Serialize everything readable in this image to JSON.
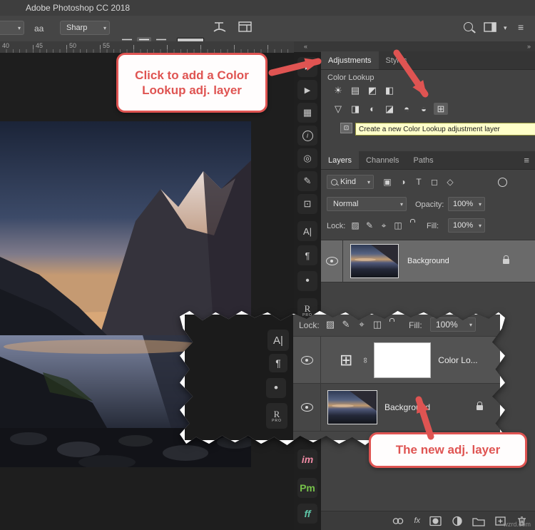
{
  "window": {
    "title": "Adobe Photoshop CC 2018"
  },
  "options_bar": {
    "aa_label": "aa",
    "antialias_value": "Sharp"
  },
  "ruler": {
    "ticks": [
      "40",
      "45",
      "50",
      "55"
    ]
  },
  "ui": {
    "chevron_down": "▾",
    "menu": "≡",
    "collapse_left": "«",
    "collapse_right": "»"
  },
  "dock": {
    "items": [
      {
        "name": "history",
        "glyph": "▸"
      },
      {
        "name": "actions",
        "glyph": "▶"
      },
      {
        "name": "tool-presets",
        "glyph": "▦"
      },
      {
        "name": "info",
        "glyph": "i"
      },
      {
        "name": "properties",
        "glyph": "◎"
      },
      {
        "name": "brush-settings",
        "glyph": "✎"
      },
      {
        "name": "clone-source",
        "glyph": "⊡"
      },
      {
        "name": "character",
        "glyph": "A|"
      },
      {
        "name": "paragraph",
        "glyph": "¶"
      },
      {
        "name": "paragraph-styles",
        "glyph": "•"
      },
      {
        "name": "r-pro",
        "glyph": "R",
        "sub": "PRO"
      },
      {
        "name": "im-extension",
        "glyph": "im"
      },
      {
        "name": "pm-extension",
        "glyph": "Pm"
      },
      {
        "name": "ff-extension",
        "glyph": "ff"
      }
    ]
  },
  "adjustments": {
    "tab_adjustments": "Adjustments",
    "tab_styles": "Styles",
    "section": "Color Lookup",
    "tooltip": "Create a new Color Lookup adjustment layer",
    "icons": {
      "brightness_contrast": "☀",
      "levels": "▤",
      "curves": "◩",
      "exposure": "◧",
      "vibrance": "▽",
      "hue_saturation": "◨",
      "color_balance": "◐",
      "black_white": "◪",
      "photo_filter": "◓",
      "channel_mixer": "◒",
      "color_lookup": "⊞",
      "tooltip_drag": "⊡"
    }
  },
  "layers": {
    "tabs": [
      "Layers",
      "Channels",
      "Paths"
    ],
    "kind_value": "Kind",
    "blend_mode": "Normal",
    "opacity_label": "Opacity:",
    "opacity_value": "100%",
    "lock_label": "Lock:",
    "fill_label": "Fill:",
    "fill_value": "100%",
    "background_name": "Background",
    "fx_label": "fx",
    "filter_icons": {
      "pixel": "▣",
      "adjustment": "◑",
      "type": "T",
      "shape": "◻",
      "smart": "◇"
    },
    "lock_icons": {
      "transparent": "▨",
      "paint": "✎",
      "move": "⌖",
      "artboard": "◫"
    }
  },
  "inset": {
    "lock_label": "Lock:",
    "fill_label": "Fill:",
    "fill_value": "100%",
    "link_glyph": "∞",
    "color_lookup_glyph": "⊞",
    "layers": [
      {
        "name": "Color Lo..."
      },
      {
        "name": "Background"
      }
    ],
    "strip": [
      {
        "glyph": "A|"
      },
      {
        "glyph": "¶"
      },
      {
        "glyph": "•"
      },
      {
        "glyph": "R",
        "sub": "PRO"
      }
    ]
  },
  "callouts": {
    "top": "Click to add a Color Lookup adj. layer",
    "bottom": "The new adj. layer"
  },
  "watermark": "wzrd.com",
  "colors": {
    "accent_red": "#df5452",
    "tooltip_bg": "#ffffc9",
    "panel_bg": "#424242",
    "selected_row": "#6a6a6a",
    "canvas_bg": "#1e1e1e",
    "ext_im": "#ef8aa4",
    "ext_pm": "#76c14a",
    "ext_ff": "#5ec3a6"
  }
}
